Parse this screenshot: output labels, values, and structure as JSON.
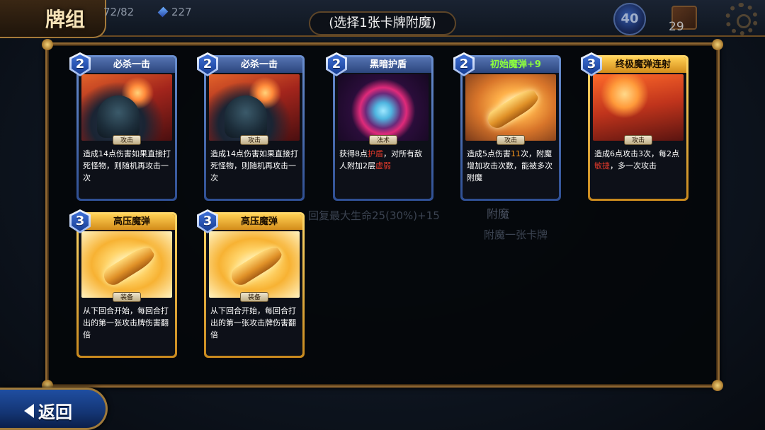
{
  "header": {
    "title": "牌组",
    "hp": "72/82",
    "gold": "227",
    "instruction": "(选择1张卡牌附魔)",
    "mana": "40",
    "deck_count": "29"
  },
  "background_text": {
    "line1": "回复最大生命25(30%)+15",
    "line2": "附魔",
    "line3": "附魔一张卡牌"
  },
  "cards": [
    {
      "cost": "2",
      "name": "必杀一击",
      "type": "攻击",
      "rarity": "blue",
      "art": "art-red",
      "desc": [
        {
          "t": "造成14点伤害如果直接打死怪物，则随机再攻击一次"
        }
      ]
    },
    {
      "cost": "2",
      "name": "必杀一击",
      "type": "攻击",
      "rarity": "blue",
      "art": "art-red",
      "desc": [
        {
          "t": "造成14点伤害如果直接打死怪物，则随机再攻击一次"
        }
      ]
    },
    {
      "cost": "2",
      "name": "黑暗护盾",
      "type": "法术",
      "rarity": "blue",
      "art": "art-magic",
      "desc": [
        {
          "t": "获得8点"
        },
        {
          "t": "护盾",
          "c": "hl-red"
        },
        {
          "t": "，对所有敌人附加2层"
        },
        {
          "t": "虚弱",
          "c": "hl-red"
        }
      ]
    },
    {
      "cost": "2",
      "name": "初始魔弹+9",
      "type": "攻击",
      "rarity": "blue",
      "art": "art-orange",
      "upgraded": true,
      "desc": [
        {
          "t": "造成5点伤害"
        },
        {
          "t": "11",
          "c": "hl-orange"
        },
        {
          "t": "次，附魔增加攻击次数，能被多次附魔"
        }
      ]
    },
    {
      "cost": "3",
      "name": "终极魔弹连射",
      "type": "攻击",
      "rarity": "gold",
      "art": "art-rockets",
      "desc": [
        {
          "t": "造成6点攻击3次，每2点"
        },
        {
          "t": "敏捷",
          "c": "hl-red"
        },
        {
          "t": "，多一次攻击"
        }
      ]
    },
    {
      "cost": "3",
      "name": "高压魔弹",
      "type": "装备",
      "rarity": "gold",
      "art": "art-gold",
      "desc": [
        {
          "t": "从下回合开始，每回合打出的第一张攻击牌伤害翻倍"
        }
      ]
    },
    {
      "cost": "3",
      "name": "高压魔弹",
      "type": "装备",
      "rarity": "gold",
      "art": "art-gold",
      "desc": [
        {
          "t": "从下回合开始，每回合打出的第一张攻击牌伤害翻倍"
        }
      ]
    }
  ],
  "footer": {
    "back_label": "返回"
  },
  "colors": {
    "panel_border": "#8c6430",
    "blue_card": "#2f4f93",
    "gold_card": "#c8891e",
    "highlight_red": "#e0392a",
    "highlight_orange": "#ff9a1a",
    "upgraded_name": "#8dff3c"
  }
}
